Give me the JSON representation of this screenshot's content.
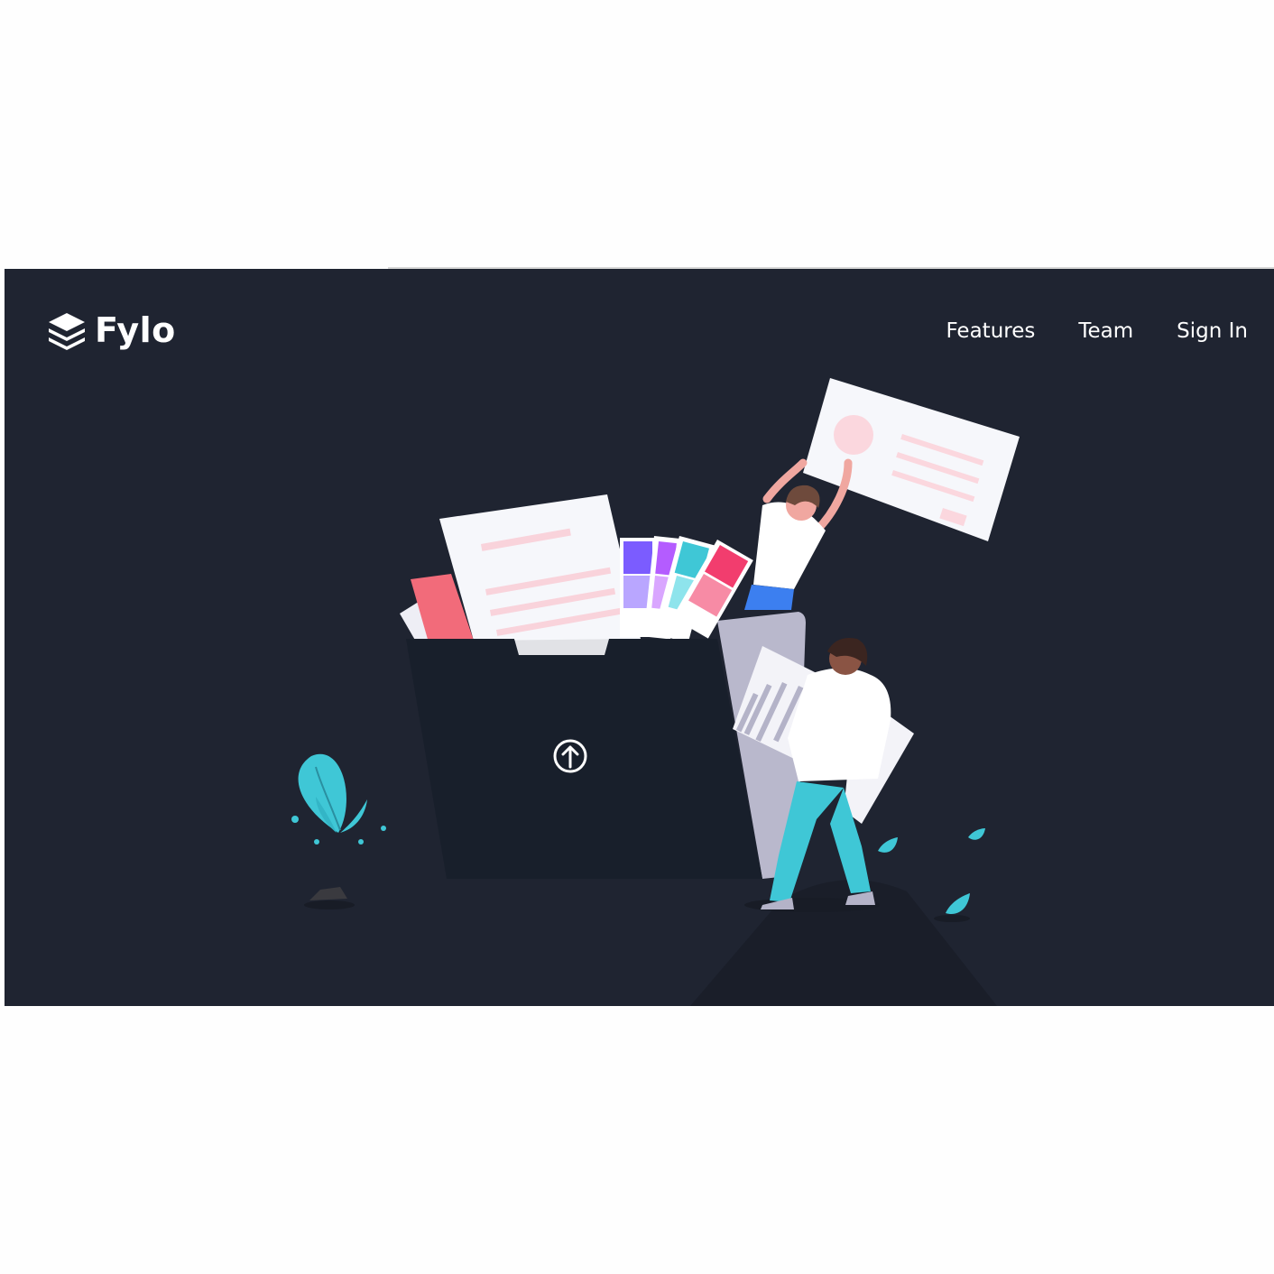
{
  "brand": {
    "name": "Fylo",
    "logo_icon": "layers-icon"
  },
  "nav": {
    "items": [
      {
        "label": "Features"
      },
      {
        "label": "Team"
      },
      {
        "label": "Sign In"
      }
    ]
  },
  "hero": {
    "background_color": "#1f2431",
    "illustration": "people-uploading-files-to-folder",
    "upload_icon": "arrow-up-circle-icon"
  },
  "colors": {
    "accent_teal": "#3fc7d6",
    "accent_pink": "#f26b7a",
    "accent_purple": "#7b5cff"
  }
}
